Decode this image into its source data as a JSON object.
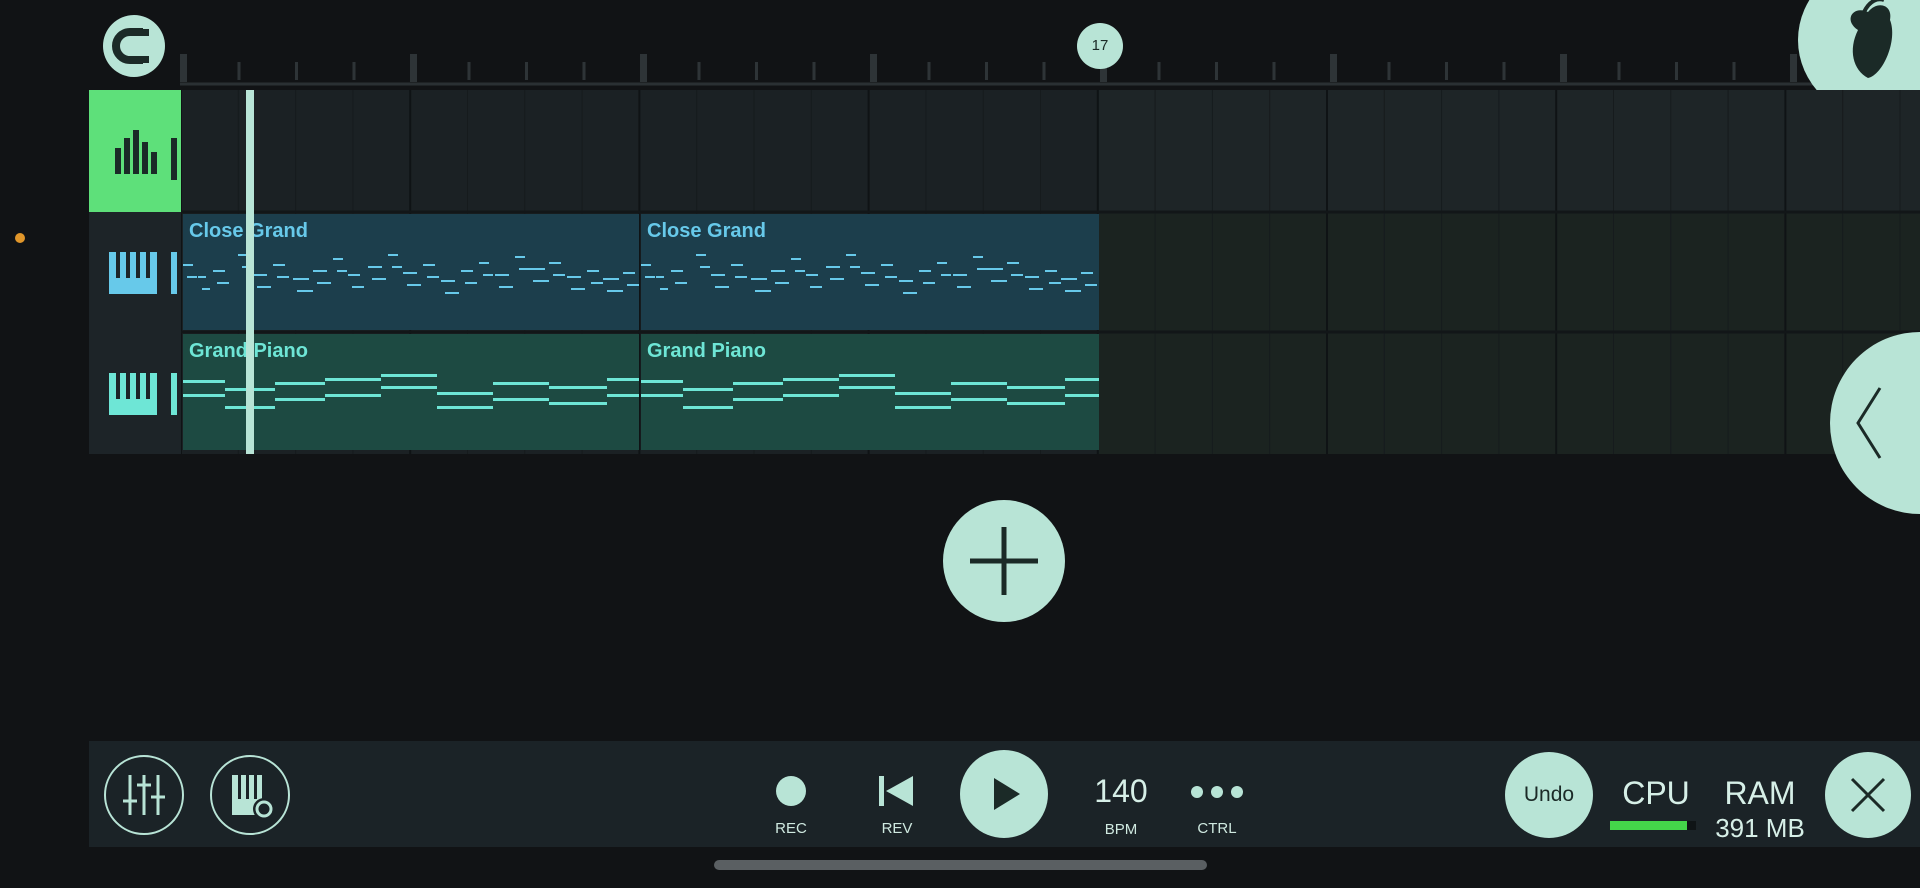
{
  "ruler": {
    "position_marker": "17"
  },
  "tracks": [
    {
      "name": "",
      "kind": "drums"
    },
    {
      "name": "Close Grand",
      "kind": "piano"
    },
    {
      "name": "Grand Piano",
      "kind": "piano"
    }
  ],
  "clips": {
    "close_grand_1": "Close Grand",
    "close_grand_2": "Close Grand",
    "grand_piano_1": "Grand Piano",
    "grand_piano_2": "Grand Piano"
  },
  "transport": {
    "rec_label": "REC",
    "rev_label": "REV",
    "bpm_value": "140",
    "bpm_label": "BPM",
    "ctrl_label": "CTRL"
  },
  "actions": {
    "undo_label": "Undo"
  },
  "stats": {
    "cpu_label": "CPU",
    "cpu_level": 0.9,
    "ram_label": "RAM",
    "ram_value": "391 MB"
  },
  "icons": [
    "magnet-icon",
    "fl-fruit-logo-icon",
    "drum-track-icon",
    "piano-track-icon",
    "add-icon",
    "chevron-left-icon",
    "mixer-icon",
    "channel-settings-icon",
    "record-icon",
    "rewind-icon",
    "play-icon",
    "more-icon",
    "close-icon"
  ],
  "colors": {
    "accent": "#b8e4d6",
    "active_track": "#5ee07a",
    "clip_close_grand": "#1c3e4c",
    "clip_grand_piano": "#1d4a42",
    "note_close_grand": "#67c9ea",
    "note_grand_piano": "#6ee6d6",
    "cpu_bar": "#44d64a"
  }
}
